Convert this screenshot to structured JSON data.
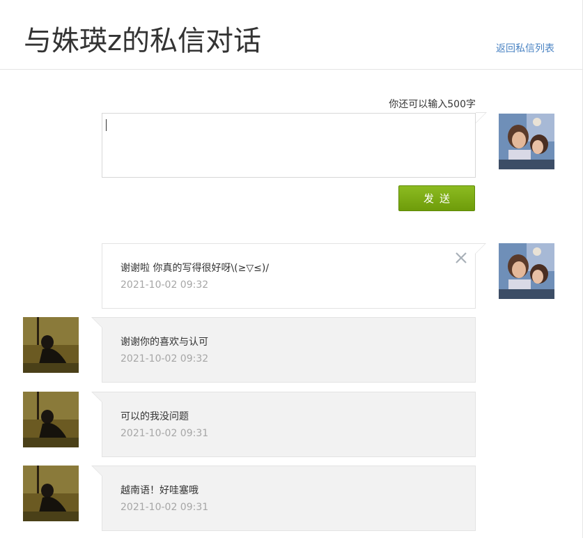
{
  "header": {
    "title": "与姝瑛z的私信对话",
    "back_link": "返回私信列表"
  },
  "composer": {
    "counter": "你还可以输入500字",
    "value": "",
    "send_label": "发送"
  },
  "colors": {
    "link": "#4a83c3",
    "send_button": "#7aab12",
    "muted_text": "#a6a6a6",
    "their_bubble": "#f2f2f2"
  },
  "messages": [
    {
      "side": "mine",
      "text": "谢谢啦 你真的写得很好呀\\(≥▽≤)/",
      "time": "2021-10-02 09:32",
      "icon": "close-icon"
    },
    {
      "side": "theirs",
      "text": "谢谢你的喜欢与认可",
      "time": "2021-10-02 09:32"
    },
    {
      "side": "theirs",
      "text": "可以的我没问题",
      "time": "2021-10-02 09:31"
    },
    {
      "side": "theirs",
      "text": "越南语！好哇塞哦",
      "time": "2021-10-02 09:31"
    }
  ]
}
